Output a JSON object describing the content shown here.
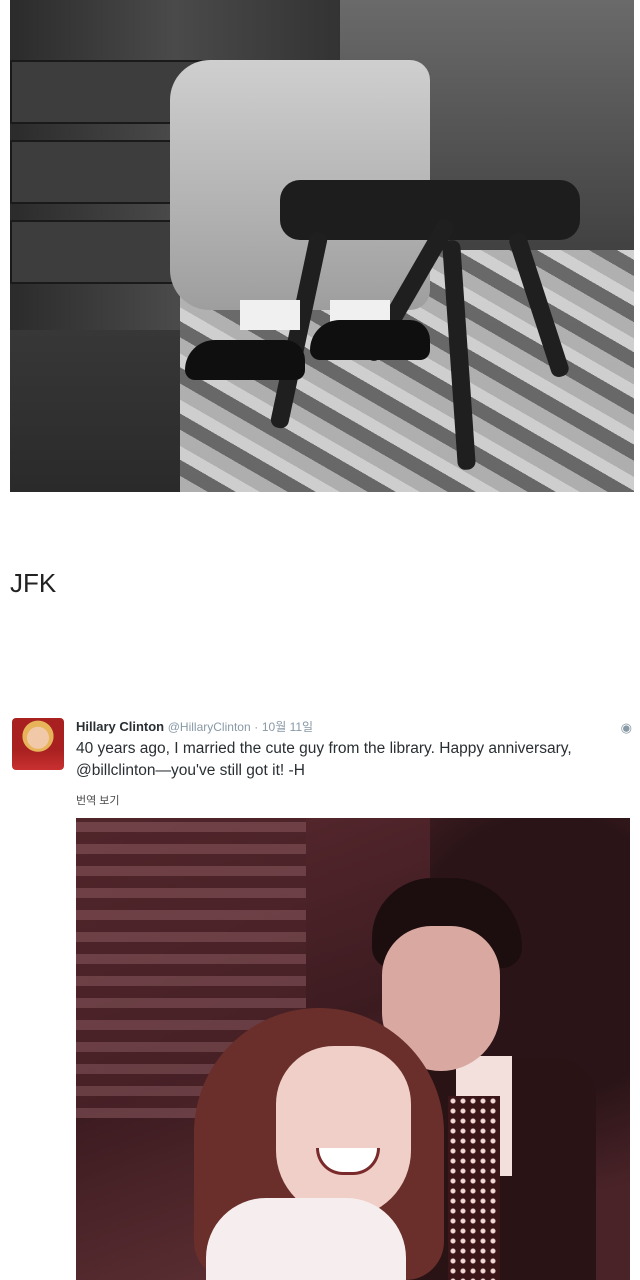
{
  "top_photo": {
    "description_icon": "photo-man-at-desk",
    "colors": {
      "tone": "#3a3a3a"
    }
  },
  "section_label": "JFK",
  "tweet": {
    "author_name": "Hillary Clinton",
    "handle": "@HillaryClinton",
    "separator": "·",
    "date": "10월 11일",
    "text": "40 years ago, I married the cute guy from the library. Happy anniversary, @billclinton—you've still got it! -H",
    "translate_label": "번역 보기",
    "icons": {
      "avatar": "avatar-image",
      "privacy": "globe-icon"
    }
  },
  "tweet_photo": {
    "description_icon": "photo-couple",
    "colors": {
      "tone": "#5b2a30"
    }
  }
}
